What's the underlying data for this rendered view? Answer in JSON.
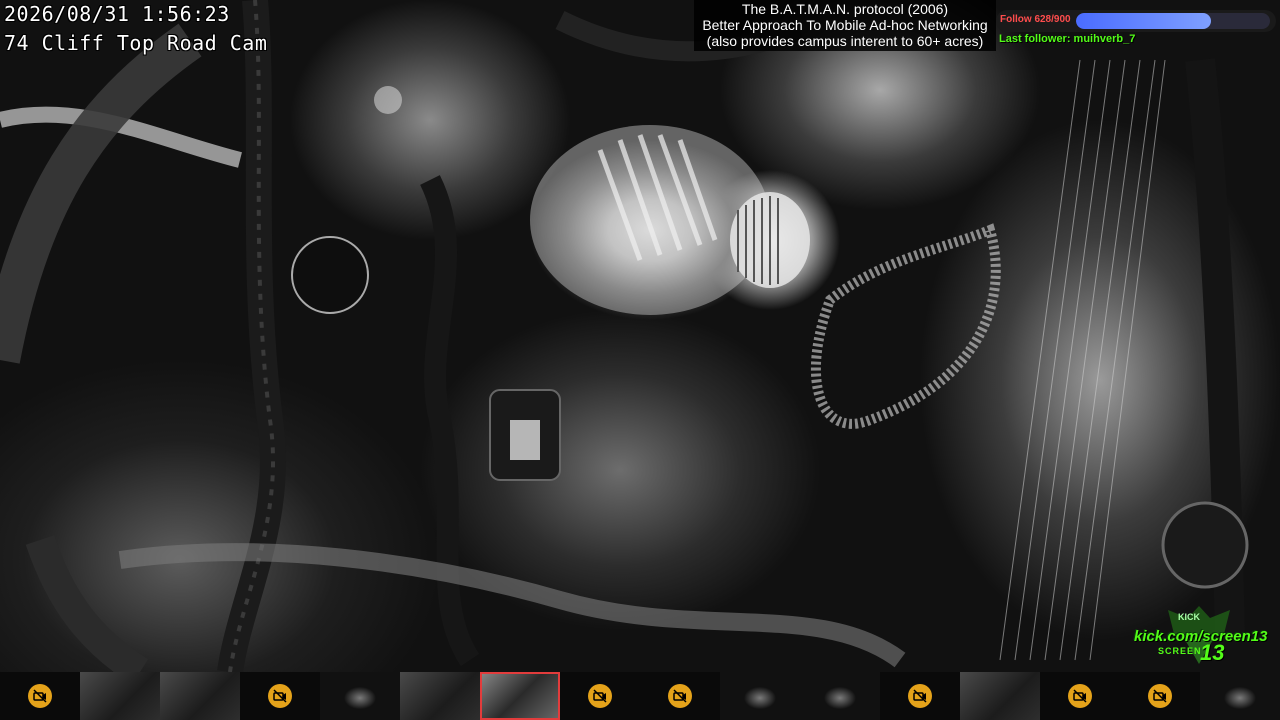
{
  "overlay": {
    "timestamp": "2026/08/31 1:56:23",
    "camera_name": "74 Cliff Top Road Cam"
  },
  "info_banner": {
    "line1": "The B.A.T.M.A.N. protocol (2006)",
    "line2": "Better Approach To Mobile Ad-hoc Networking",
    "line3": "(also provides campus interent to 60+ acres)"
  },
  "follow_goal": {
    "label": "Follow 628/900",
    "current": 628,
    "target": 900,
    "progress": 0.698,
    "fill_color": "#5b7cff",
    "label_color": "#ff4d4d"
  },
  "last_follower": {
    "text": "Last follower: muihverb_7"
  },
  "branding": {
    "kick_small": "KICK",
    "url": "kick.com/screen13",
    "brand": "SCREEN",
    "number": "13",
    "color": "#53fc18"
  },
  "camera_strip": {
    "thumbnails": [
      {
        "state": "off",
        "icon": "camera-off-icon"
      },
      {
        "state": "live"
      },
      {
        "state": "live"
      },
      {
        "state": "off",
        "icon": "camera-off-icon"
      },
      {
        "state": "dark"
      },
      {
        "state": "live"
      },
      {
        "state": "active"
      },
      {
        "state": "off",
        "icon": "camera-off-icon"
      },
      {
        "state": "off",
        "icon": "camera-off-icon"
      },
      {
        "state": "dark"
      },
      {
        "state": "dark"
      },
      {
        "state": "off",
        "icon": "camera-off-icon"
      },
      {
        "state": "live"
      },
      {
        "state": "off",
        "icon": "camera-off-icon"
      },
      {
        "state": "off",
        "icon": "camera-off-icon"
      },
      {
        "state": "dark"
      }
    ],
    "active_color": "#e23c3c",
    "icon_color": "#e5a31a"
  }
}
